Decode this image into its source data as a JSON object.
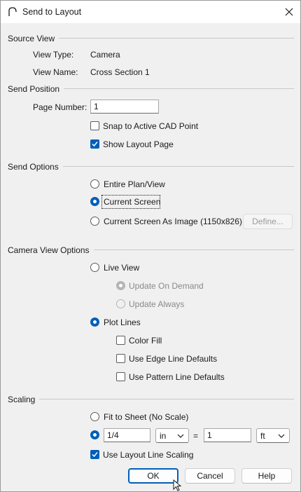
{
  "window": {
    "title": "Send to Layout"
  },
  "source_view": {
    "label": "Source View",
    "view_type_label": "View Type:",
    "view_type_value": "Camera",
    "view_name_label": "View Name:",
    "view_name_value": "Cross Section 1"
  },
  "send_position": {
    "label": "Send Position",
    "page_number_label": "Page Number:",
    "page_number_value": "1",
    "snap_label": "Snap to Active CAD Point",
    "snap_checked": false,
    "show_layout_label": "Show Layout Page",
    "show_layout_checked": true
  },
  "send_options": {
    "label": "Send Options",
    "entire_plan_label": "Entire Plan/View",
    "current_screen_label": "Current Screen",
    "current_screen_image_label": "Current Screen As Image (1150x826)",
    "define_button": "Define...",
    "selected": "current_screen"
  },
  "camera_view_options": {
    "label": "Camera View Options",
    "live_view_label": "Live View",
    "update_on_demand_label": "Update On Demand",
    "update_always_label": "Update Always",
    "plot_lines_label": "Plot Lines",
    "color_fill_label": "Color Fill",
    "edge_line_label": "Use Edge Line Defaults",
    "pattern_line_label": "Use Pattern Line Defaults"
  },
  "scaling": {
    "label": "Scaling",
    "fit_to_sheet_label": "Fit to Sheet (No Scale)",
    "scale_left_value": "1/4",
    "scale_left_unit": "in",
    "equals": "=",
    "scale_right_value": "1",
    "scale_right_unit": "ft",
    "layout_line_scaling_label": "Use Layout Line Scaling"
  },
  "buttons": {
    "ok": "OK",
    "cancel": "Cancel",
    "help": "Help"
  },
  "colors": {
    "accent": "#005fb8",
    "dialog_bg": "#f0f0f0"
  }
}
